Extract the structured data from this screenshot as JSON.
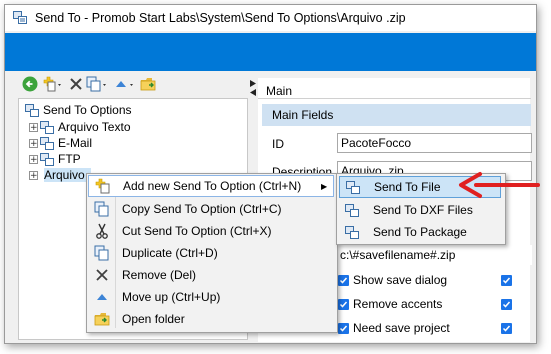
{
  "window": {
    "title": "Send To - Promob Start Labs\\System\\Send To Options\\Arquivo .zip"
  },
  "colors": {
    "ribbon": "#0078d7",
    "section_bar": "#cfe1f2",
    "arrow": "#e02020",
    "checkbox": "#1a73e8"
  },
  "toolbar": {
    "icons": [
      "back-icon",
      "new-icon",
      "delete-icon",
      "copy-icon",
      "move-up-icon",
      "open-folder-icon"
    ]
  },
  "tree": {
    "root": "Send To Options",
    "items": [
      "Arquivo Texto",
      "E-Mail",
      "FTP",
      "Arquivo .zip"
    ]
  },
  "right_pane": {
    "header": "Main",
    "section": "Main Fields",
    "id_label": "ID",
    "id_value": "PacoteFocco",
    "description_label": "Description",
    "description_value": "Arquivo .zip",
    "filename_value": "c:\\#savefilename#.zip",
    "checks": [
      "Show save dialog",
      "Remove accents",
      "Need save project"
    ]
  },
  "context_menu": {
    "items": [
      {
        "label": "Add new Send To Option (Ctrl+N)",
        "icon": "add-option-icon",
        "submenu_arrow": "▶"
      },
      {
        "label": "Copy Send To Option (Ctrl+C)",
        "icon": "copy-icon"
      },
      {
        "label": "Cut Send To Option (Ctrl+X)",
        "icon": "scissors-icon"
      },
      {
        "label": "Duplicate (Ctrl+D)",
        "icon": "duplicate-icon"
      },
      {
        "label": "Remove (Del)",
        "icon": "remove-icon"
      },
      {
        "label": "Move up (Ctrl+Up)",
        "icon": "move-up-icon"
      },
      {
        "label": "Open folder",
        "icon": "folder-icon"
      }
    ]
  },
  "submenu": {
    "items": [
      "Send To File",
      "Send To DXF Files",
      "Send To Package"
    ]
  }
}
